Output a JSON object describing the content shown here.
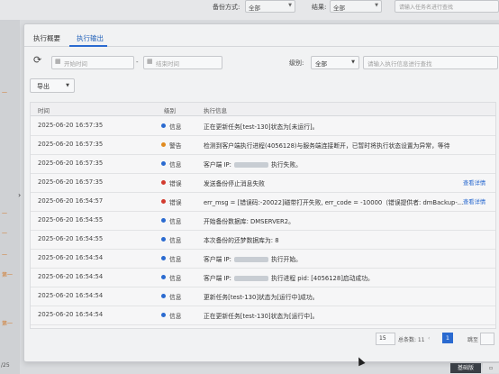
{
  "topbar": {
    "backup_mode_label": "备份方式:",
    "backup_mode_value": "全部",
    "result_label": "结果:",
    "result_value": "全部",
    "search_placeholder": "请输入任务名进行查找"
  },
  "left": {
    "ticks": [
      "一",
      "一",
      "一",
      "一",
      "第一",
      "第一"
    ],
    "page_fragment": "/25"
  },
  "tabs": [
    {
      "label": "执行概要",
      "active": false
    },
    {
      "label": "执行输出",
      "active": true
    }
  ],
  "toolbar": {
    "start_placeholder": "开始时间",
    "end_placeholder": "结束时间",
    "dash": "-",
    "level_label": "级别:",
    "level_value": "全部",
    "keyword_placeholder": "请输入执行信息进行查找",
    "export_label": "导出"
  },
  "table": {
    "headers": {
      "time": "时间",
      "level": "级别",
      "message": "执行信息"
    },
    "rows": [
      {
        "time": "2025-06-20 16:57:35",
        "level": "信息",
        "dot": "#2a6ad0",
        "pre": "正在更新任务[test-130]状态为[未运行]。",
        "blur": false,
        "post": "",
        "detail": ""
      },
      {
        "time": "2025-06-20 16:57:35",
        "level": "警告",
        "dot": "#e08a1e",
        "pre": "检测到客户端执行进程(4056128)与服务端连接断开，已暂时将执行状态设置为异常，等待",
        "blur": false,
        "post": "",
        "detail": ""
      },
      {
        "time": "2025-06-20 16:57:35",
        "level": "信息",
        "dot": "#2a6ad0",
        "pre": "客户端 IP:",
        "blur": true,
        "post": "执行失败。",
        "detail": ""
      },
      {
        "time": "2025-06-20 16:57:35",
        "level": "错误",
        "dot": "#d23a2e",
        "pre": "发送备份停止消息失败",
        "blur": false,
        "post": "",
        "detail": "查看详情"
      },
      {
        "time": "2025-06-20 16:54:57",
        "level": "错误",
        "dot": "#d23a2e",
        "pre": "err_msg = [错误码:-20022]磁带打开失败, err_code = -10000（错误提供者: dmBackup-...",
        "blur": false,
        "post": "",
        "detail": "查看详情"
      },
      {
        "time": "2025-06-20 16:54:55",
        "level": "信息",
        "dot": "#2a6ad0",
        "pre": "开始备份数据库: DMSERVER2。",
        "blur": false,
        "post": "",
        "detail": ""
      },
      {
        "time": "2025-06-20 16:54:55",
        "level": "信息",
        "dot": "#2a6ad0",
        "pre": "本次备份的还梦数据库为: 8",
        "blur": false,
        "post": "",
        "detail": ""
      },
      {
        "time": "2025-06-20 16:54:54",
        "level": "信息",
        "dot": "#2a6ad0",
        "pre": "客户端 IP:",
        "blur": true,
        "post": "执行开始。",
        "detail": ""
      },
      {
        "time": "2025-06-20 16:54:54",
        "level": "信息",
        "dot": "#2a6ad0",
        "pre": "客户端 IP:",
        "blur": true,
        "post": "执行进程 pid: [4056128]启动成功。",
        "detail": ""
      },
      {
        "time": "2025-06-20 16:54:54",
        "level": "信息",
        "dot": "#2a6ad0",
        "pre": "更新任务[test-130]状态为[运行中]成功。",
        "blur": false,
        "post": "",
        "detail": ""
      },
      {
        "time": "2025-06-20 16:54:54",
        "level": "信息",
        "dot": "#2a6ad0",
        "pre": "正在更新任务[test-130]状态为[运行中]。",
        "blur": false,
        "post": "",
        "detail": ""
      }
    ]
  },
  "pager": {
    "page_size": "15",
    "total_label": "总条数: 11",
    "prev": "‹",
    "current": "1",
    "goto_label": "跳至"
  },
  "taskbar": {
    "label": "基础版",
    "corner": "▫"
  }
}
